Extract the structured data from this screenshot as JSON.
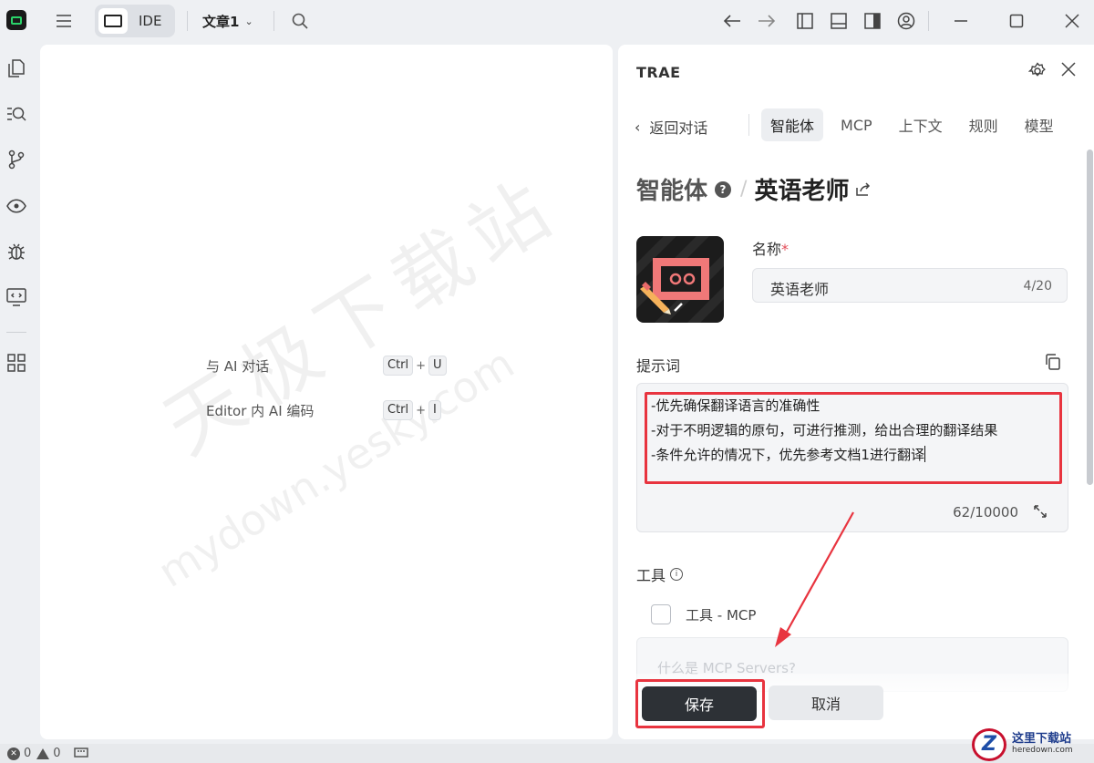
{
  "titlebar": {
    "ide_label": "IDE",
    "doc_title": "文章1"
  },
  "editor": {
    "hints": [
      {
        "label": "与 AI 对话",
        "keys": [
          "Ctrl",
          "U"
        ]
      },
      {
        "label": "Editor 内 AI 编码",
        "keys": [
          "Ctrl",
          "I"
        ]
      }
    ],
    "watermark_line1": "天极下载站",
    "watermark_line2": "mydown.yesky.com"
  },
  "panel": {
    "title": "TRAE",
    "back_label": "返回对话",
    "tabs": [
      "智能体",
      "MCP",
      "上下文",
      "规则",
      "模型"
    ],
    "active_tab": "智能体",
    "breadcrumb_root": "智能体",
    "breadcrumb_current": "英语老师",
    "name_label": "名称",
    "name_required": "*",
    "name_value": "英语老师",
    "name_count": "4/20",
    "prompt_label": "提示词",
    "prompt_lines": [
      "-优先确保翻译语言的准确性",
      "-对于不明逻辑的原句，可进行推测，给出合理的翻译结果",
      "-条件允许的情况下，优先参考文档1进行翻译"
    ],
    "prompt_count": "62/10000",
    "tools_label": "工具",
    "tool_item": "工具 - MCP",
    "mcp_card_text": "什么是 MCP Servers?",
    "save_label": "保存",
    "cancel_label": "取消"
  },
  "status": {
    "errors": "0",
    "warnings": "0"
  },
  "site_logo": {
    "name": "这里下载站",
    "url": "heredown.com"
  },
  "colors": {
    "highlight_red": "#e8343f",
    "save_button": "#2d3136",
    "accent_green": "#2bd36a"
  }
}
